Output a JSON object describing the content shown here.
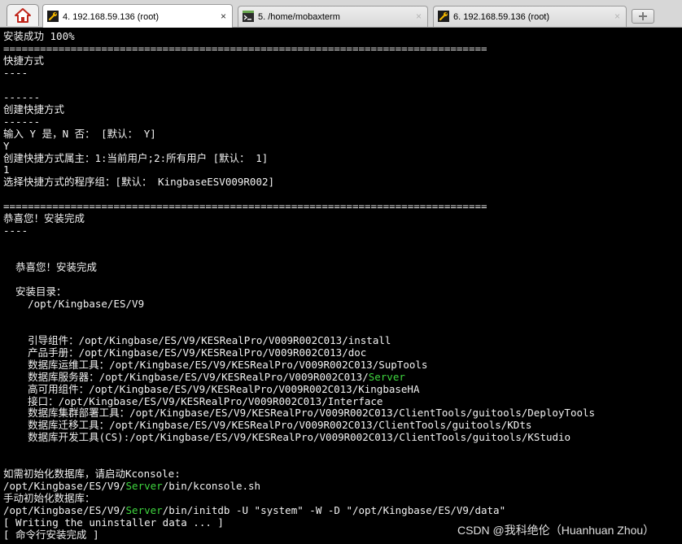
{
  "tabs": [
    {
      "label": "4. 192.168.59.136 (root)",
      "icon": "wrench-icon",
      "active": true
    },
    {
      "label": "5. /home/mobaxterm",
      "icon": "terminal-icon",
      "active": false
    },
    {
      "label": "6. 192.168.59.136 (root)",
      "icon": "wrench-icon",
      "active": false
    }
  ],
  "home_icon": "home-icon",
  "new_tab_icon": "plus-icon",
  "close_glyph": "×",
  "colors": {
    "terminal_bg": "#000000",
    "text": "#f2f2f2",
    "highlight_green": "#3fd53f"
  },
  "terminal": {
    "lines": [
      [
        "安装成功 100%"
      ],
      [
        "==============================================================================="
      ],
      [
        "快捷方式"
      ],
      [
        "----"
      ],
      [
        ""
      ],
      [
        "------"
      ],
      [
        "创建快捷方式"
      ],
      [
        "------"
      ],
      [
        "输入 Y 是，N 否： [默认： Y]"
      ],
      [
        "Y"
      ],
      [
        "创建快捷方式属主：1:当前用户;2:所有用户 [默认： 1]"
      ],
      [
        "1"
      ],
      [
        "选择快捷方式的程序组：[默认： KingbaseESV009R002]"
      ],
      [
        ""
      ],
      [
        "==============================================================================="
      ],
      [
        "恭喜您！安装完成"
      ],
      [
        "----"
      ],
      [
        ""
      ],
      [
        ""
      ],
      [
        "  恭喜您！安装完成"
      ],
      [
        ""
      ],
      [
        "  安装目录："
      ],
      [
        "    /opt/Kingbase/ES/V9"
      ],
      [
        ""
      ],
      [
        ""
      ],
      [
        "    引导组件：/opt/Kingbase/ES/V9/KESRealPro/V009R002C013/install"
      ],
      [
        "    产品手册：/opt/Kingbase/ES/V9/KESRealPro/V009R002C013/doc"
      ],
      [
        "    数据库运维工具：/opt/Kingbase/ES/V9/KESRealPro/V009R002C013/SupTools"
      ],
      [
        "    数据库服务器：/opt/Kingbase/ES/V9/KESRealPro/V009R002C013/",
        "Server"
      ],
      [
        "    高可用组件：/opt/Kingbase/ES/V9/KESRealPro/V009R002C013/KingbaseHA"
      ],
      [
        "    接口：/opt/Kingbase/ES/V9/KESRealPro/V009R002C013/Interface"
      ],
      [
        "    数据库集群部署工具：/opt/Kingbase/ES/V9/KESRealPro/V009R002C013/ClientTools/guitools/DeployTools"
      ],
      [
        "    数据库迁移工具：/opt/Kingbase/ES/V9/KESRealPro/V009R002C013/ClientTools/guitools/KDts"
      ],
      [
        "    数据库开发工具(CS):/opt/Kingbase/ES/V9/KESRealPro/V009R002C013/ClientTools/guitools/KStudio"
      ],
      [
        ""
      ],
      [
        ""
      ],
      [
        "如需初始化数据库，请启动Kconsole:"
      ],
      [
        "/opt/Kingbase/ES/V9/",
        "Server",
        "/bin/kconsole.sh"
      ],
      [
        "手动初始化数据库："
      ],
      [
        "/opt/Kingbase/ES/V9/",
        "Server",
        "/bin/initdb -U \"system\" -W -D \"/opt/Kingbase/ES/V9/data\""
      ],
      [
        "[ Writing the uninstaller data ... ]"
      ],
      [
        "[ 命令行安装完成 ]"
      ]
    ]
  },
  "watermark": "CSDN @我科绝伦（Huanhuan Zhou）"
}
